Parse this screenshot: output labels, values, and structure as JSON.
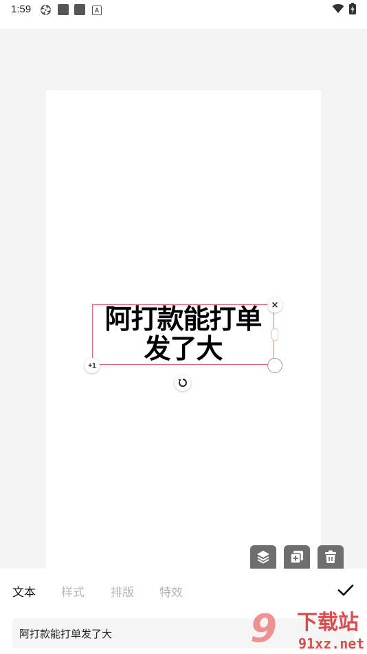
{
  "status_bar": {
    "time": "1:59",
    "left_icons": [
      "aperture-icon",
      "app-square-icon",
      "app-square-icon",
      "a-badge-icon"
    ],
    "a_badge_text": "A",
    "right_icons": [
      "wifi-icon",
      "battery-charging-icon"
    ]
  },
  "editor": {
    "sticker_text": "阿打款能打单\n发了大",
    "close_glyph": "×",
    "plus_badge": "+1",
    "selection_color": "#e36b6b"
  },
  "tools": {
    "icons": [
      "layers-icon",
      "duplicate-icon",
      "delete-icon"
    ]
  },
  "bottom_panel": {
    "tabs": [
      {
        "label": "文本",
        "active": true
      },
      {
        "label": "样式",
        "active": false
      },
      {
        "label": "排版",
        "active": false
      },
      {
        "label": "特效",
        "active": false
      }
    ],
    "input_value": "阿打款能打单发了大",
    "confirm_icon": "check-icon"
  },
  "watermark": {
    "mark": "9",
    "title": "下载站",
    "url": "91xz.net"
  }
}
